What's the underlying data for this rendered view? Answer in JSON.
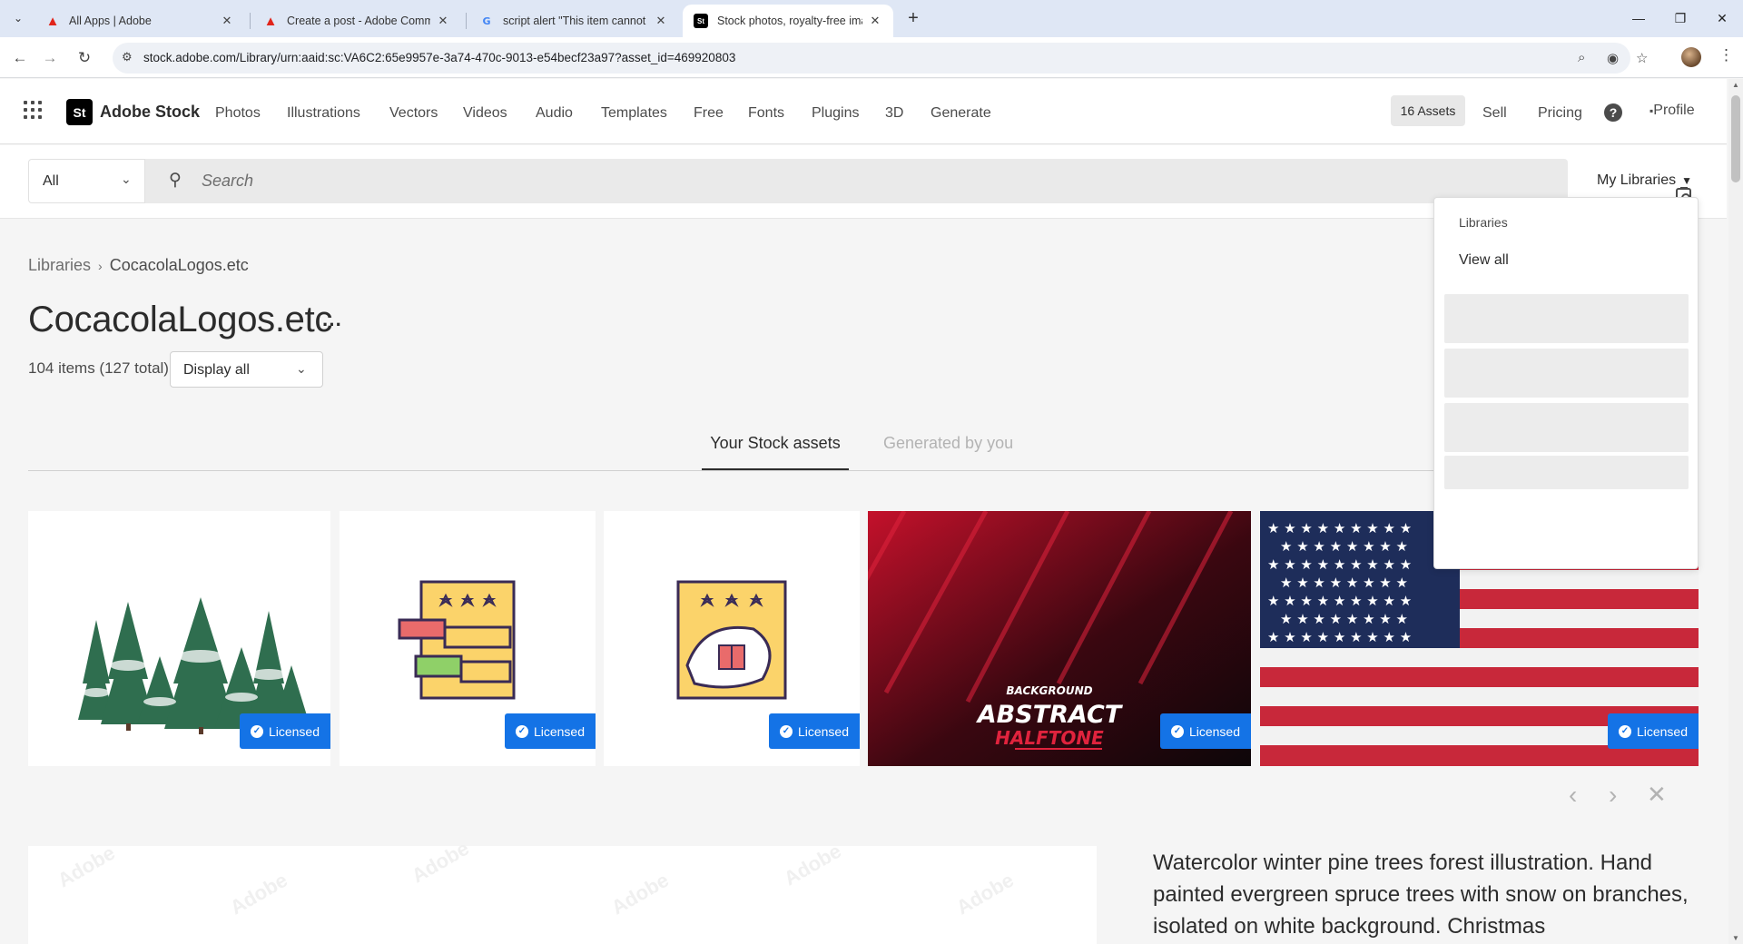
{
  "browser": {
    "tabs": [
      {
        "title": "All Apps | Adobe",
        "favicon": "adobe-icon"
      },
      {
        "title": "Create a post - Adobe Commun",
        "favicon": "adobe-icon"
      },
      {
        "title": "script alert \"This item cannot ed",
        "favicon": "google-icon"
      },
      {
        "title": "Stock photos, royalty-free imag",
        "favicon": "adobe-stock-icon"
      }
    ],
    "url": "stock.adobe.com/Library/urn:aaid:sc:VA6C2:65e9957e-3a74-470c-9013-e54becf23a97?asset_id=469920803"
  },
  "header": {
    "logo_text": "St",
    "brand": "Adobe Stock",
    "nav": [
      "Photos",
      "Illustrations",
      "Vectors",
      "Videos",
      "Audio",
      "Templates",
      "Free",
      "Fonts",
      "Plugins",
      "3D",
      "Generate"
    ],
    "assets_label": "16 Assets",
    "sell": "Sell",
    "pricing": "Pricing",
    "help_glyph": "?",
    "profile_alt": "Profile"
  },
  "search": {
    "scope": "All",
    "placeholder": "Search",
    "my_libraries": "My Libraries"
  },
  "library": {
    "breadcrumb_root": "Libraries",
    "breadcrumb_current": "CocacolaLogos.etc",
    "title": "CocacolaLogos.etc",
    "count": "104 items (127 total)",
    "display_filter": "Display all"
  },
  "tabs": {
    "stock": "Your Stock assets",
    "generated": "Generated by you"
  },
  "assets": [
    {
      "name": "winter pine trees",
      "badge": "Licensed"
    },
    {
      "name": "coupon ticket icon",
      "badge": "Licensed"
    },
    {
      "name": "gift ticket icon",
      "badge": "Licensed"
    },
    {
      "name": "abstract halftone background",
      "badge": "Licensed",
      "line1": "BACKGROUND",
      "line2": "ABSTRACT",
      "line3": "HALFTONE"
    },
    {
      "name": "american flag",
      "badge": "Licensed"
    }
  ],
  "detail": {
    "description": "Watercolor winter pine trees forest illustration. Hand painted evergreen spruce trees with snow on branches, isolated on white background. Christmas"
  },
  "libraries_dropdown": {
    "header": "Libraries",
    "view_all": "View all"
  },
  "colors": {
    "accent": "#1473e6",
    "tab_bar": "#dfe7f5"
  }
}
